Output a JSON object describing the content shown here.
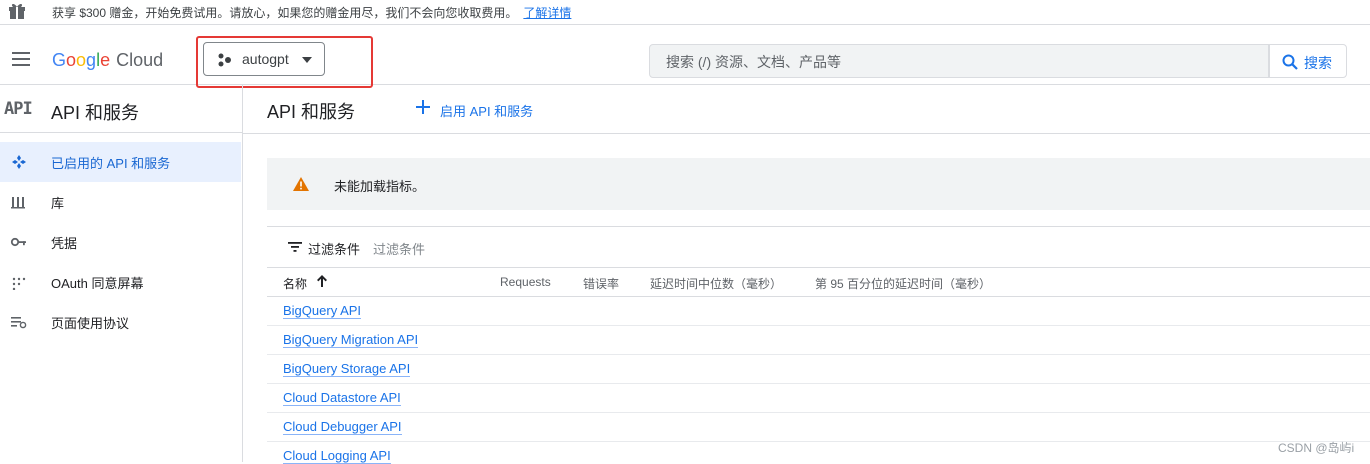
{
  "promo": {
    "gift_icon": "gift-icon",
    "text": "获享 $300 赠金，开始免费试用。请放心，如果您的赠金用尽，我们不会向您收取费用。",
    "link": "了解详情"
  },
  "header": {
    "menu_icon": "hamburger-menu-icon",
    "logo": {
      "g": "G",
      "o1": "o",
      "o2": "o",
      "g2": "g",
      "l": "l",
      "e": "e",
      "cloud": "Cloud"
    },
    "project": {
      "name": "autogpt",
      "icon": "project-dots-icon",
      "caret_icon": "caret-down-icon"
    },
    "search": {
      "placeholder": "搜索 (/) 资源、文档、产品等",
      "button_label": "搜索",
      "icon": "search-icon"
    }
  },
  "sidebar": {
    "badge": "API",
    "title": "API 和服务",
    "items": [
      {
        "label": "已启用的 API 和服务",
        "icon": "api-diamond-icon",
        "active": true
      },
      {
        "label": "库",
        "icon": "library-icon",
        "active": false
      },
      {
        "label": "凭据",
        "icon": "key-icon",
        "active": false
      },
      {
        "label": "OAuth 同意屏幕",
        "icon": "consent-dots-icon",
        "active": false
      },
      {
        "label": "页面使用协议",
        "icon": "agreement-list-icon",
        "active": false
      }
    ]
  },
  "main": {
    "title": "API 和服务",
    "enable_button": "启用 API 和服务",
    "alert": {
      "icon": "warning-icon",
      "text": "未能加载指标。"
    },
    "filter": {
      "label": "过滤条件",
      "placeholder": "过滤条件",
      "icon": "filter-icon"
    },
    "table": {
      "columns": [
        "名称",
        "Requests",
        "错误率",
        "延迟时间中位数（毫秒）",
        "第 95 百分位的延迟时间（毫秒）"
      ],
      "sort_icon": "arrow-up-icon",
      "rows": [
        "BigQuery API",
        "BigQuery Migration API",
        "BigQuery Storage API",
        "Cloud Datastore API",
        "Cloud Debugger API",
        "Cloud Logging API"
      ]
    }
  },
  "watermark": "CSDN @岛屿i",
  "colors": {
    "accent": "#1a73e8",
    "highlight_box": "#e53935",
    "active_nav_bg": "#e8f0fe",
    "warning": "#e37400"
  }
}
